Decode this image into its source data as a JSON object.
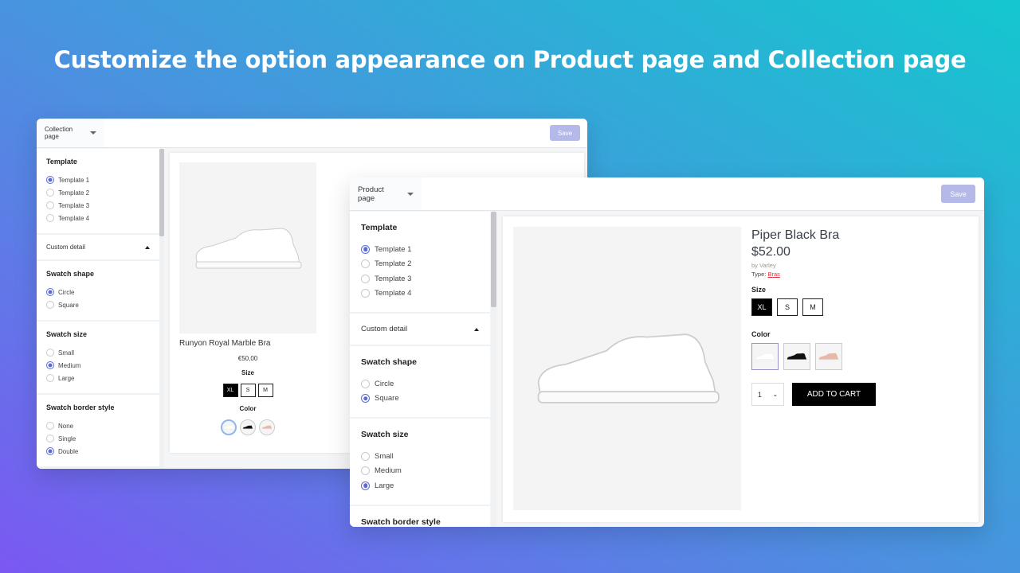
{
  "headline": "Customize the option appearance on Product page and Collection page",
  "collection": {
    "page_select": "Collection page",
    "save": "Save",
    "template": {
      "title": "Template",
      "options": [
        "Template 1",
        "Template 2",
        "Template 3",
        "Template 4"
      ],
      "selected": 0
    },
    "custom_detail": "Custom detail",
    "swatch_shape": {
      "title": "Swatch shape",
      "options": [
        "Circle",
        "Square"
      ],
      "selected": 0
    },
    "swatch_size": {
      "title": "Swatch size",
      "options": [
        "Small",
        "Medium",
        "Large"
      ],
      "selected": 1
    },
    "swatch_border": {
      "title": "Swatch border style",
      "options": [
        "None",
        "Single",
        "Double"
      ],
      "selected": 2
    },
    "product": {
      "name": "Runyon Royal Marble Bra",
      "price": "€50,00",
      "size_label": "Size",
      "sizes": [
        "XL",
        "S",
        "M"
      ],
      "color_label": "Color",
      "colors": [
        "#ffffff",
        "#111111",
        "#e8b9a8"
      ]
    }
  },
  "product": {
    "page_select": "Product page",
    "save": "Save",
    "template": {
      "title": "Template",
      "options": [
        "Template 1",
        "Template 2",
        "Template 3",
        "Template 4"
      ],
      "selected": 0
    },
    "custom_detail": "Custom detail",
    "swatch_shape": {
      "title": "Swatch shape",
      "options": [
        "Circle",
        "Square"
      ],
      "selected": 1
    },
    "swatch_size": {
      "title": "Swatch size",
      "options": [
        "Small",
        "Medium",
        "Large"
      ],
      "selected": 2
    },
    "swatch_border": {
      "title": "Swatch border style"
    },
    "item": {
      "name": "Piper Black Bra",
      "price": "$52.00",
      "vendor": "by Varley",
      "type_label": "Type:",
      "type": "Bras",
      "size_label": "Size",
      "sizes": [
        "XL",
        "S",
        "M"
      ],
      "color_label": "Color",
      "colors": [
        "#ffffff",
        "#111111",
        "#e8b9a8"
      ],
      "qty": "1",
      "add_to_cart": "ADD TO CART"
    }
  },
  "colors": {
    "accent": "#5b6bd6",
    "save_disabled": "#b4b9ea",
    "link": "#e0303a"
  }
}
